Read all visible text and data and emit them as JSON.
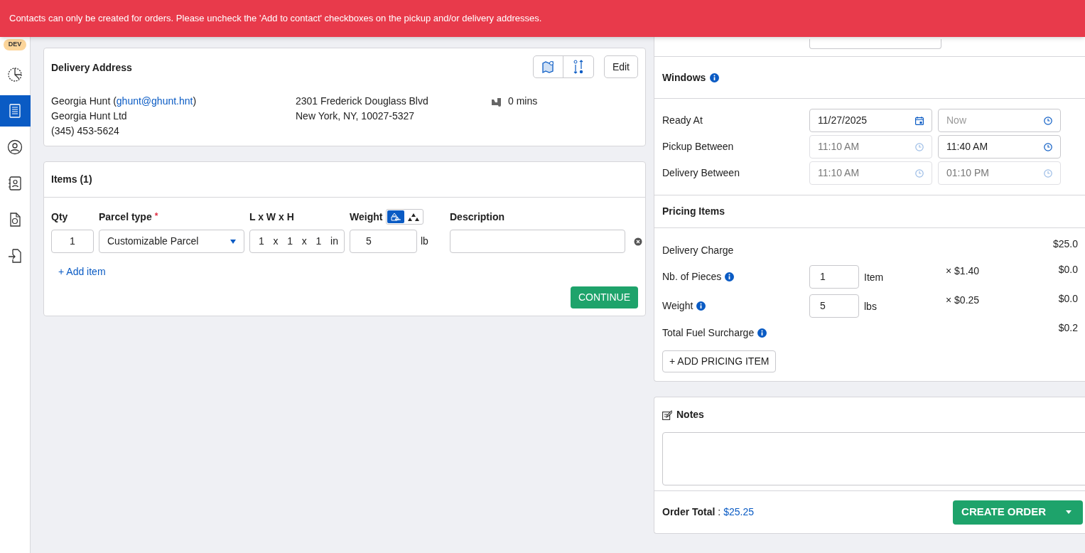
{
  "alert": {
    "message": "Contacts can only be created for orders. Please uncheck the 'Add to contact' checkboxes on the pickup and/or delivery addresses."
  },
  "sidebar": {
    "badge": "DEV",
    "items": [
      {
        "kind": "chart",
        "selected": false
      },
      {
        "kind": "receipt",
        "selected": true
      },
      {
        "kind": "user",
        "selected": false
      },
      {
        "kind": "contacts",
        "selected": false
      },
      {
        "kind": "document",
        "selected": false
      },
      {
        "kind": "import",
        "selected": false
      }
    ]
  },
  "delivery_address": {
    "title": "Delivery Address",
    "name": "Georgia Hunt",
    "email_open": "(",
    "email": "ghunt@ghunt.hnt",
    "email_close": ")",
    "company": "Georgia Hunt Ltd",
    "phone": "(345) 453-5624",
    "street": "2301 Frederick Douglass Blvd",
    "city": "New York, NY, 10027-5327",
    "duration": "0 mins",
    "edit_button": "Edit"
  },
  "items": {
    "title": "Items (1)",
    "required_mark": "*",
    "columns": [
      {
        "label": "Qty",
        "required": false
      },
      {
        "label": "Parcel type",
        "required": true
      },
      {
        "label": "L x W x H",
        "required": false
      },
      {
        "label": "Weight",
        "required": false
      },
      {
        "label": "Description",
        "required": false
      }
    ],
    "weight_modes": [
      {
        "kind": "individual",
        "selected": true
      },
      {
        "kind": "total",
        "selected": false
      }
    ],
    "rows": [
      {
        "qty": "1",
        "parcel_type": "Customizable Parcel",
        "dims": [
          "1",
          "1",
          "1"
        ],
        "dims_separators": [
          "x",
          "x"
        ],
        "dims_unit": "in",
        "weight": "5",
        "weight_unit": "lb"
      }
    ],
    "add_item": "+ Add item",
    "continue_button": "CONTINUE"
  },
  "windows": {
    "title": "Windows",
    "rows": [
      {
        "label": "Ready At",
        "fields": [
          {
            "kind": "date",
            "value": "11/27/2025",
            "disabled": false
          },
          {
            "kind": "time",
            "placeholder": "Now",
            "disabled": false
          }
        ]
      },
      {
        "label": "Pickup Between",
        "fields": [
          {
            "kind": "time",
            "value": "11:10 AM",
            "disabled": true
          },
          {
            "kind": "time",
            "value": "11:40 AM",
            "disabled": false
          }
        ]
      },
      {
        "label": "Delivery Between",
        "fields": [
          {
            "kind": "time",
            "value": "11:10 AM",
            "disabled": true
          },
          {
            "kind": "time",
            "value": "01:10 PM",
            "disabled": true
          }
        ]
      }
    ]
  },
  "pricing": {
    "title": "Pricing Items",
    "rows": [
      {
        "label": "Delivery Charge",
        "info": false,
        "amount": "$25.0"
      },
      {
        "label": "Nb. of Pieces",
        "info": true,
        "quantity": "1",
        "unit": "Item",
        "rate": "× $1.40",
        "amount": "$0.0"
      },
      {
        "label": "Weight",
        "info": true,
        "quantity": "5",
        "unit": "lbs",
        "rate": "× $0.25",
        "amount": "$0.0"
      },
      {
        "label": "Total Fuel Surcharge",
        "info": true,
        "amount": "$0.2"
      }
    ],
    "add_button": "+ ADD PRICING ITEM"
  },
  "notes": {
    "title": "Notes"
  },
  "order_total": {
    "label": "**Order Total** :",
    "value": "$25.25"
  },
  "create_button": "CREATE ORDER"
}
